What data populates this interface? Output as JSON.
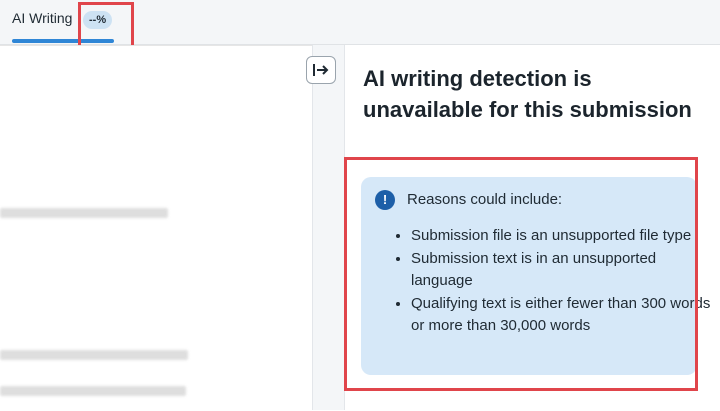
{
  "tabs": [
    {
      "label": "AI Writing",
      "badge": "--%"
    }
  ],
  "panel": {
    "title": "AI writing detection is unavailable for this submission",
    "info": {
      "icon": "exclamation-circle-icon",
      "heading": "Reasons could include:",
      "reasons": [
        "Submission file is an unsupported file type",
        "Submission text is in an unsupported language",
        "Qualifying text is either fewer than 300 words or more than 30,000 words"
      ]
    }
  },
  "colors": {
    "accent": "#2f86d6",
    "highlight": "#e0454b",
    "info_bg": "#d6e8f8",
    "info_icon": "#1d5fa8"
  }
}
